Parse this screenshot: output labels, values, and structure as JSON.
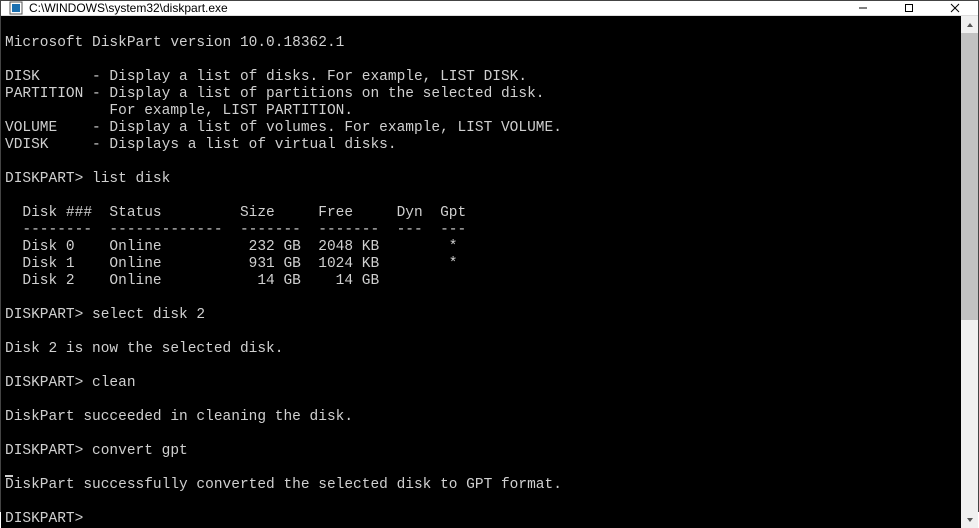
{
  "title": "C:\\WINDOWS\\system32\\diskpart.exe",
  "version_line": "Microsoft DiskPart version 10.0.18362.1",
  "help": [
    {
      "cmd": "DISK",
      "pad": "      ",
      "desc": "- Display a list of disks. For example, LIST DISK."
    },
    {
      "cmd": "PARTITION",
      "pad": " ",
      "desc": "- Display a list of partitions on the selected disk."
    },
    {
      "cmd": "",
      "pad": "            ",
      "desc": "For example, LIST PARTITION."
    },
    {
      "cmd": "VOLUME",
      "pad": "    ",
      "desc": "- Display a list of volumes. For example, LIST VOLUME."
    },
    {
      "cmd": "VDISK",
      "pad": "     ",
      "desc": "- Displays a list of virtual disks."
    }
  ],
  "prompt": "DISKPART>",
  "cmd1": "list disk",
  "table": {
    "header": "  Disk ###  Status         Size     Free     Dyn  Gpt",
    "divider": "  --------  -------------  -------  -------  ---  ---",
    "rows": [
      "  Disk 0    Online          232 GB  2048 KB        *",
      "  Disk 1    Online          931 GB  1024 KB        *",
      "  Disk 2    Online           14 GB    14 GB"
    ]
  },
  "cmd2": "select disk 2",
  "msg_select": "Disk 2 is now the selected disk.",
  "cmd3": "clean",
  "msg_clean": "DiskPart succeeded in cleaning the disk.",
  "cmd4": "convert gpt",
  "msg_convert": "DiskPart successfully converted the selected disk to GPT format."
}
